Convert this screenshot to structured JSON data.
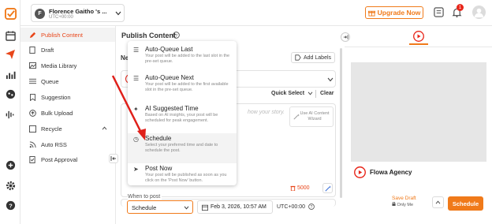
{
  "workspace": {
    "avatar_letter": "F",
    "name": "Florence Gaitho 's ...",
    "timezone": "UTC+00:00"
  },
  "header": {
    "upgrade_label": "Upgrade Now",
    "notification_count": "1"
  },
  "sidebar": {
    "items": [
      {
        "label": "Publish Content"
      },
      {
        "label": "Draft"
      },
      {
        "label": "Media Library"
      },
      {
        "label": "Queue"
      },
      {
        "label": "Suggestion"
      },
      {
        "label": "Bulk Upload"
      },
      {
        "label": "Recycle"
      },
      {
        "label": "Auto RSS"
      },
      {
        "label": "Post Approval"
      }
    ]
  },
  "main": {
    "title": "Publish Content",
    "new_prefix": "Ne",
    "add_labels": "Add Labels",
    "quick_select": "Quick Select",
    "clear": "Clear",
    "editor_placeholder": "how your story.",
    "ai_content_wizard": "Use AI Content Wizard",
    "char_count": "5000",
    "when_to_post": "When to post",
    "schedule_select": "Schedule",
    "date_value": "Feb 3, 2026, 10:57 AM",
    "timezone": "UTC+00:00",
    "save_draft": "Save Draft",
    "only_me": "Only Me",
    "schedule_button": "Schedule"
  },
  "menu": {
    "items": [
      {
        "title": "Auto-Queue Last",
        "desc": "Your post will be added to the last slot in the pre-set queue."
      },
      {
        "title": "Auto-Queue Next",
        "desc": "Your post will be added to the first available slot in the pre-set queue."
      },
      {
        "title": "AI Suggested Time",
        "desc": "Based on AI insights, your post will be scheduled for peak engagement."
      },
      {
        "title": "Schedule",
        "desc": "Select your preferred time and date to schedule the post."
      },
      {
        "title": "Post Now",
        "desc": "Your post will be published as soon as you click on the 'Post Now' button."
      }
    ]
  },
  "preview": {
    "channel_name": "Flowa Agency"
  },
  "colors": {
    "accent": "#f07a1a",
    "youtube_red": "#e8261a",
    "arrow": "#e0201a"
  }
}
